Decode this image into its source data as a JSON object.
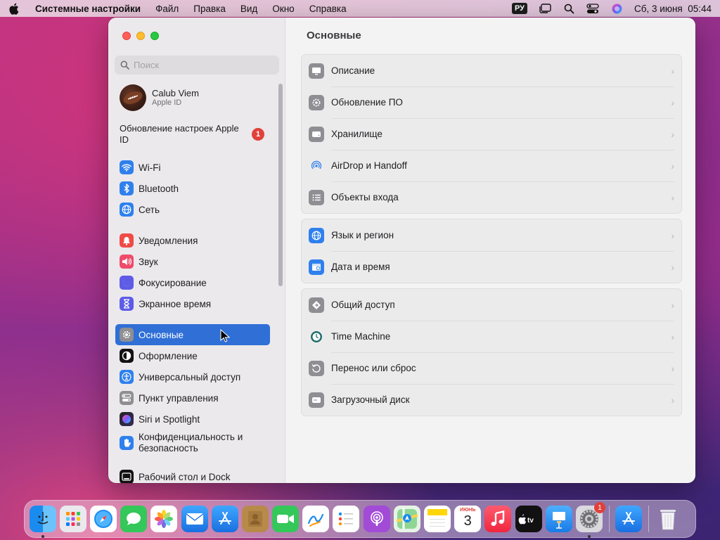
{
  "menubar": {
    "app_name": "Системные настройки",
    "items": [
      "Файл",
      "Правка",
      "Вид",
      "Окно",
      "Справка"
    ],
    "input_source": "РУ",
    "datetime": "Сб, 3 июня  05:44"
  },
  "sidebar": {
    "search_placeholder": "Поиск",
    "account": {
      "name": "Calub Viem",
      "subtitle": "Apple ID"
    },
    "update": {
      "label": "Обновление настроек Apple ID",
      "badge": "1"
    },
    "group1": [
      {
        "label": "Wi‑Fi",
        "icon": "wifi-icon"
      },
      {
        "label": "Bluetooth",
        "icon": "bluetooth-icon"
      },
      {
        "label": "Сеть",
        "icon": "network-globe-icon"
      }
    ],
    "group2": [
      {
        "label": "Уведомления",
        "icon": "bell-icon"
      },
      {
        "label": "Звук",
        "icon": "speaker-icon"
      },
      {
        "label": "Фокусирование",
        "icon": "moon-icon"
      },
      {
        "label": "Экранное время",
        "icon": "hourglass-icon"
      }
    ],
    "group3": [
      {
        "label": "Основные",
        "icon": "gear-icon",
        "selected": true
      },
      {
        "label": "Оформление",
        "icon": "appearance-icon"
      },
      {
        "label": "Универсальный доступ",
        "icon": "accessibility-icon"
      },
      {
        "label": "Пункт управления",
        "icon": "control-center-icon"
      },
      {
        "label": "Siri и Spotlight",
        "icon": "siri-icon"
      },
      {
        "label": "Конфиденциальность и безопасность",
        "icon": "hand-icon"
      }
    ],
    "group4": [
      {
        "label": "Рабочий стол и Dock",
        "icon": "dock-icon"
      }
    ]
  },
  "main": {
    "title": "Основные",
    "card1": [
      {
        "label": "Описание",
        "icon": "display-icon"
      },
      {
        "label": "Обновление ПО",
        "icon": "software-update-icon"
      },
      {
        "label": "Хранилище",
        "icon": "storage-icon"
      },
      {
        "label": "AirDrop и Handoff",
        "icon": "airdrop-icon"
      },
      {
        "label": "Объекты входа",
        "icon": "login-items-icon"
      }
    ],
    "card2": [
      {
        "label": "Язык и регион",
        "icon": "globe-icon"
      },
      {
        "label": "Дата и время",
        "icon": "calendar-clock-icon"
      }
    ],
    "card3": [
      {
        "label": "Общий доступ",
        "icon": "sharing-icon"
      },
      {
        "label": "Time Machine",
        "icon": "time-machine-icon"
      },
      {
        "label": "Перенос или сброс",
        "icon": "reset-icon"
      },
      {
        "label": "Загрузочный диск",
        "icon": "startup-disk-icon"
      }
    ]
  },
  "dock": {
    "calendar_month": "ИЮНЬ",
    "calendar_day": "3",
    "settings_badge": "1"
  }
}
